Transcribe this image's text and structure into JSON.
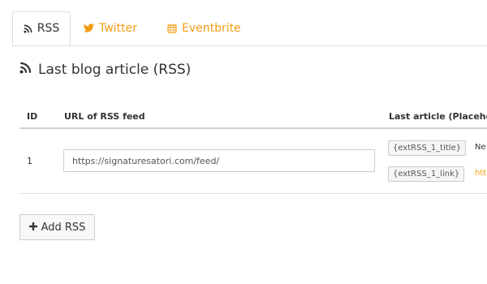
{
  "tabs": [
    {
      "label": "RSS",
      "icon": "rss-icon",
      "active": true
    },
    {
      "label": "Twitter",
      "icon": "twitter-icon",
      "active": false
    },
    {
      "label": "Eventbrite",
      "icon": "calendar-icon",
      "active": false
    }
  ],
  "section": {
    "title": "Last blog article (RSS)",
    "icon": "rss-icon"
  },
  "table": {
    "headers": [
      "ID",
      "URL of RSS feed",
      "Last article (Placehol"
    ],
    "rows": [
      {
        "id": "1",
        "url": "https://signaturesatori.com/feed/",
        "placeholders": [
          {
            "tag": "{extRSS_1_title}",
            "preview": "Ne"
          },
          {
            "tag": "{extRSS_1_link}",
            "preview": "htt"
          }
        ]
      }
    ]
  },
  "add_button": {
    "label": "Add RSS",
    "icon": "plus-icon"
  },
  "colors": {
    "accent": "#f39c12",
    "border": "#dddddd",
    "text": "#333333"
  }
}
